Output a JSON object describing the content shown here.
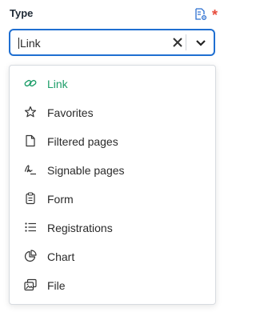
{
  "field": {
    "label": "Type",
    "required_mark": "*",
    "meta_icon": "settings-doc-icon"
  },
  "select": {
    "value": "Link",
    "clear_icon": "close-icon",
    "toggle_icon": "chevron-down-icon"
  },
  "colors": {
    "accent": "#1f6fd1",
    "selected": "#1e9e6a",
    "required": "#e74c3c"
  },
  "options": [
    {
      "label": "Link",
      "icon": "link-icon",
      "selected": true
    },
    {
      "label": "Favorites",
      "icon": "star-icon",
      "selected": false
    },
    {
      "label": "Filtered pages",
      "icon": "page-icon",
      "selected": false
    },
    {
      "label": "Signable pages",
      "icon": "signature-icon",
      "selected": false
    },
    {
      "label": "Form",
      "icon": "clipboard-icon",
      "selected": false
    },
    {
      "label": "Registrations",
      "icon": "list-icon",
      "selected": false
    },
    {
      "label": "Chart",
      "icon": "pie-chart-icon",
      "selected": false
    },
    {
      "label": "File",
      "icon": "images-icon",
      "selected": false
    }
  ]
}
